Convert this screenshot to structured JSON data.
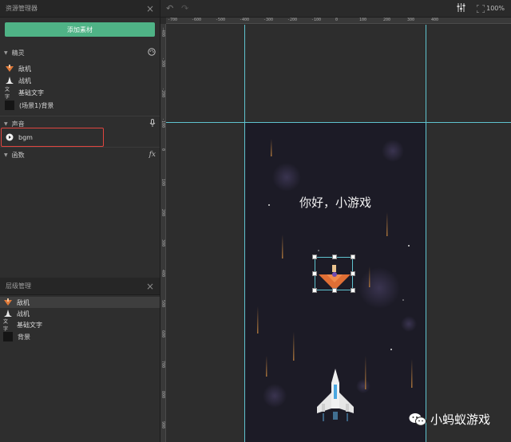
{
  "assets_panel": {
    "title": "资源管理器",
    "add_button": "添加素材",
    "sprites_section": "精灵",
    "sprites": [
      {
        "label": "敌机",
        "icon": "enemy-plane-icon"
      },
      {
        "label": "战机",
        "icon": "fighter-plane-icon"
      },
      {
        "label": "基础文字",
        "icon": "text-icon"
      },
      {
        "label": "(场景1)背景",
        "icon": "background-icon"
      }
    ],
    "sound_section": "声音",
    "sounds": [
      {
        "label": "bgm",
        "icon": "play-icon"
      }
    ],
    "functions_section": "函数",
    "functions_icon_text": "fx"
  },
  "layers_panel": {
    "title": "层级管理",
    "layers": [
      {
        "label": "敌机",
        "selected": true
      },
      {
        "label": "战机",
        "selected": false
      },
      {
        "label": "基础文字",
        "selected": false
      },
      {
        "label": "背景",
        "selected": false
      }
    ]
  },
  "toolbar": {
    "zoom": "100%"
  },
  "ruler": {
    "top_labels": [
      "-700",
      "-600",
      "-500",
      "-400",
      "-300",
      "-200",
      "-100",
      "0",
      "100",
      "200",
      "300",
      "400"
    ],
    "left_labels": [
      "-400",
      "-300",
      "-200",
      "-100",
      "0",
      "100",
      "200",
      "300",
      "400",
      "500",
      "600",
      "700",
      "800",
      "900"
    ]
  },
  "stage": {
    "text": "你好，小游戏"
  },
  "watermark": {
    "text": "小蚂蚁游戏"
  },
  "colors": {
    "accent_green": "#4fb386",
    "guide_cyan": "#5fc3cf",
    "highlight_red": "#e0453f",
    "stage_bg": "#1c1b26"
  }
}
